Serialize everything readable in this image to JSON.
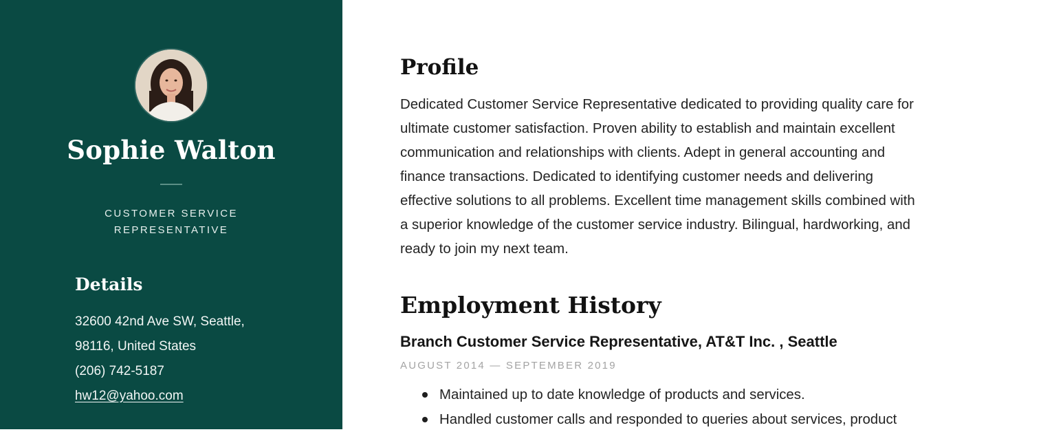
{
  "sidebar": {
    "name": "Sophie Walton",
    "job_title": "CUSTOMER SERVICE REPRESENTATIVE",
    "details_heading": "Details",
    "address_line1": "32600 42nd Ave SW, Seattle,",
    "address_line2": "98116, United States",
    "phone": "(206) 742-5187",
    "email": "hw12@yahoo.com"
  },
  "profile": {
    "heading": "Profile",
    "lines": [
      "Dedicated Customer Service Representative dedicated to providing quality care for",
      "ultimate customer satisfaction. Proven ability to establish and maintain excellent",
      "communication and relationships with clients. Adept in general accounting and",
      "finance transactions. Dedicated to identifying customer needs and delivering",
      "effective solutions to all problems. Excellent time management skills combined with",
      "a superior knowledge of the customer service industry. Bilingual, hardworking, and",
      "ready to join my next team."
    ]
  },
  "employment": {
    "heading": "Employment History",
    "jobs": [
      {
        "role": "Branch Customer Service Representative, AT&T Inc. , Seattle",
        "dates": "AUGUST 2014 — SEPTEMBER 2019",
        "bullets": [
          "Maintained up to date knowledge of products and services.",
          "Handled customer calls and responded to queries about services, product"
        ]
      }
    ]
  },
  "colors": {
    "sidebar_bg": "#0a4a43",
    "divider": "#5c8f86",
    "dates_gray": "#a3a3a3"
  }
}
